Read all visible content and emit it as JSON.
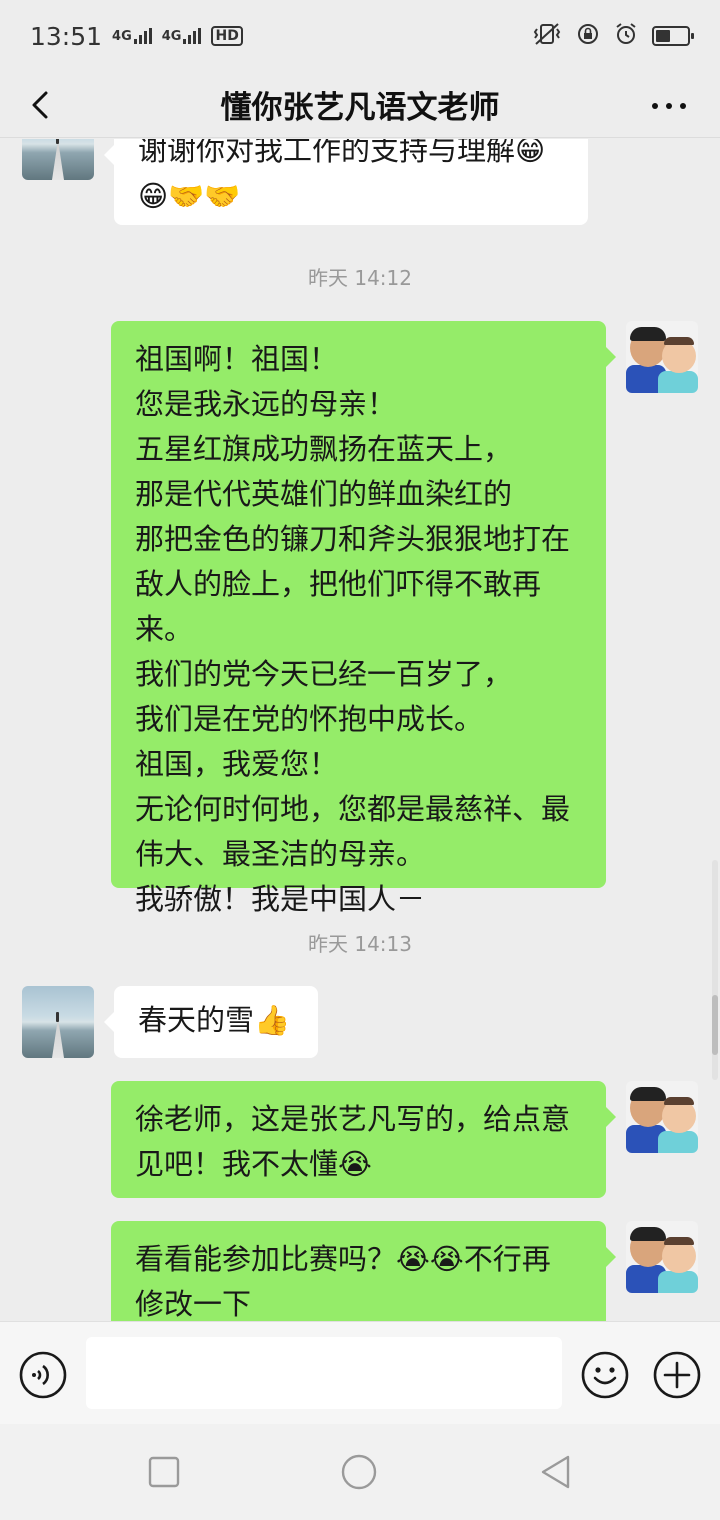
{
  "status_bar": {
    "time": "13:51",
    "network_1": "4G",
    "network_2": "4G",
    "hd": "HD"
  },
  "header": {
    "title": "懂你张艺凡语文老师"
  },
  "messages": [
    {
      "side": "left",
      "text": "谢谢你对我工作的支持与理解😁\n😁🤝🤝"
    },
    {
      "timestamp": "昨天 14:12"
    },
    {
      "side": "right",
      "text": "祖国啊！祖国！\n您是我永远的母亲！\n五星红旗成功飘扬在蓝天上，\n那是代代英雄们的鲜血染红的\n那把金色的镰刀和斧头狠狠地打在\n敌人的脸上，把他们吓得不敢再来。\n我们的党今天已经一百岁了，\n我们是在党的怀抱中成长。\n祖国，我爱您！\n无论何时何地，您都是最慈祥、最\n伟大、最圣洁的母亲。\n我骄傲！我是中国人－"
    },
    {
      "timestamp": "昨天 14:13"
    },
    {
      "side": "left",
      "text": "春天的雪👍"
    },
    {
      "side": "right",
      "text": "徐老师，这是张艺凡写的，给点意\n见吧！我不太懂😭"
    },
    {
      "side": "right",
      "text": "看看能参加比赛吗？😭😭不行再\n修改一下"
    }
  ],
  "input": {
    "value": "",
    "placeholder": ""
  },
  "colors": {
    "background": "#ededed",
    "bubble_self": "#95ec69",
    "bubble_other": "#ffffff"
  },
  "icons": [
    "back-icon",
    "more-icon",
    "voice-icon",
    "emoji-icon",
    "plus-icon",
    "recent-apps-icon",
    "home-icon",
    "back-triangle-icon"
  ]
}
